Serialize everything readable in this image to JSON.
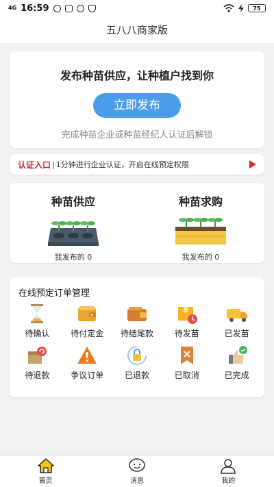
{
  "status_bar": {
    "network": "4G",
    "time": "16:59",
    "battery": "75"
  },
  "header": {
    "title": "五八八商家版"
  },
  "publish": {
    "headline": "发布种苗供应，让种植户找到你",
    "button_label": "立即发布",
    "hint": "完成种苗企业或种苗经纪人认证后解锁"
  },
  "certification": {
    "tag": "认证入口",
    "separator": "|",
    "text": "1分钟进行企业认证，开启在线预定权限"
  },
  "supply_demand": {
    "supply": {
      "title": "种苗供应",
      "count_label": "我发布的 0"
    },
    "demand": {
      "title": "种苗求购",
      "count_label": "我发布的 0"
    }
  },
  "orders": {
    "heading": "在线预定订单管理",
    "items": [
      {
        "label": "待确认",
        "icon": "hourglass-icon"
      },
      {
        "label": "待付定金",
        "icon": "wallet-icon"
      },
      {
        "label": "待结尾款",
        "icon": "purse-icon"
      },
      {
        "label": "待发苗",
        "icon": "package-clock-icon"
      },
      {
        "label": "已发苗",
        "icon": "truck-icon"
      },
      {
        "label": "待退款",
        "icon": "refund-box-icon"
      },
      {
        "label": "争议订单",
        "icon": "warning-icon"
      },
      {
        "label": "已退款",
        "icon": "refunded-lock-icon"
      },
      {
        "label": "已取消",
        "icon": "cancelled-bookmark-icon"
      },
      {
        "label": "已完成",
        "icon": "thumbs-up-icon"
      }
    ]
  },
  "tabbar": {
    "items": [
      {
        "label": "首页",
        "icon": "home-icon"
      },
      {
        "label": "消息",
        "icon": "message-icon"
      },
      {
        "label": "我的",
        "icon": "user-icon"
      }
    ]
  },
  "colors": {
    "accent_blue": "#4a9de8",
    "cert_red": "#d8262a",
    "home_yellow": "#f5c518"
  }
}
